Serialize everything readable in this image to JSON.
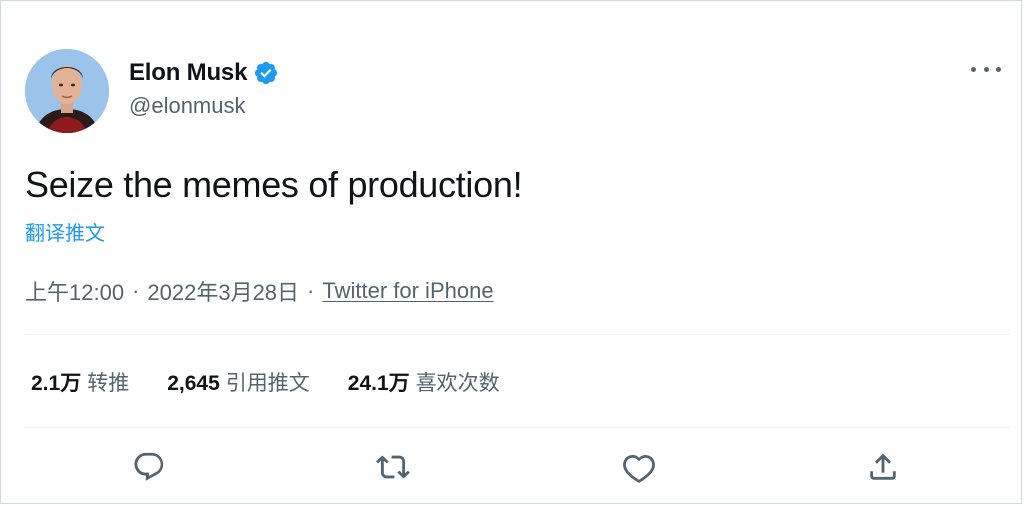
{
  "user": {
    "display_name": "Elon Musk",
    "handle": "@elonmusk",
    "verified": true
  },
  "tweet": {
    "text": "Seize the memes of production!",
    "translate_label": "翻译推文"
  },
  "meta": {
    "time": "上午12:00",
    "separator": "·",
    "date": "2022年3月28日",
    "separator2": "·",
    "source": "Twitter for iPhone"
  },
  "stats": [
    {
      "value": "2.1万",
      "label": "转推"
    },
    {
      "value": "2,645",
      "label": "引用推文"
    },
    {
      "value": "24.1万",
      "label": "喜欢次数"
    }
  ],
  "icons": {
    "more": "more-horizontal-icon",
    "verified": "verified-badge-icon",
    "reply": "reply-icon",
    "retweet": "retweet-icon",
    "like": "heart-icon",
    "share": "share-icon"
  },
  "colors": {
    "accent": "#1d9bf0",
    "text_primary": "#0f1419",
    "text_secondary": "#536471",
    "divider": "#eff3f4"
  }
}
